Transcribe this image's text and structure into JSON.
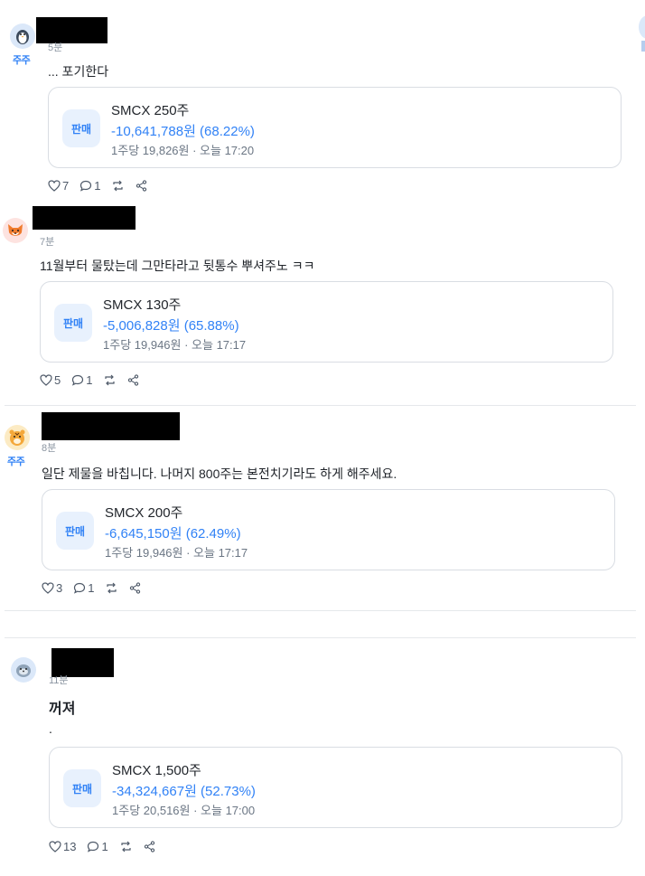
{
  "common": {
    "sell_label": "판매",
    "holder_badge": "주주"
  },
  "posts": [
    {
      "time": "5분",
      "text": "... 포기한다",
      "trade": {
        "title": "SMCX 250주",
        "amount": "-10,641,788원 (68.22%)",
        "meta": "1주당 19,826원 · 오늘 17:20"
      },
      "likes": "7",
      "comments": "1"
    },
    {
      "time": "7분",
      "text": "11월부터 물탔는데 그만타라고 뒷통수 뿌셔주노 ㅋㅋ",
      "trade": {
        "title": "SMCX 130주",
        "amount": "-5,006,828원 (65.88%)",
        "meta": "1주당 19,946원 · 오늘 17:17"
      },
      "likes": "5",
      "comments": "1"
    },
    {
      "time": "8분",
      "text": "일단 제물을 바칩니다. 나머지 800주는 본전치기라도 하게 해주세요.",
      "trade": {
        "title": "SMCX 200주",
        "amount": "-6,645,150원 (62.49%)",
        "meta": "1주당 19,946원 · 오늘 17:17"
      },
      "likes": "3",
      "comments": "1"
    },
    {
      "time": "11분",
      "title": "꺼져",
      "text": ".",
      "trade": {
        "title": "SMCX 1,500주",
        "amount": "-34,324,667원 (52.73%)",
        "meta": "1주당 20,516원 · 오늘 17:00"
      },
      "likes": "13",
      "comments": "1"
    }
  ],
  "avatars": [
    "penguin-avatar",
    "fox-avatar",
    "tiger-avatar",
    "seal-avatar"
  ],
  "colors": {
    "accent": "#3182f6",
    "badge_bg": "#e8f1fd",
    "muted": "#8b95a1",
    "border": "#d9dde3"
  }
}
